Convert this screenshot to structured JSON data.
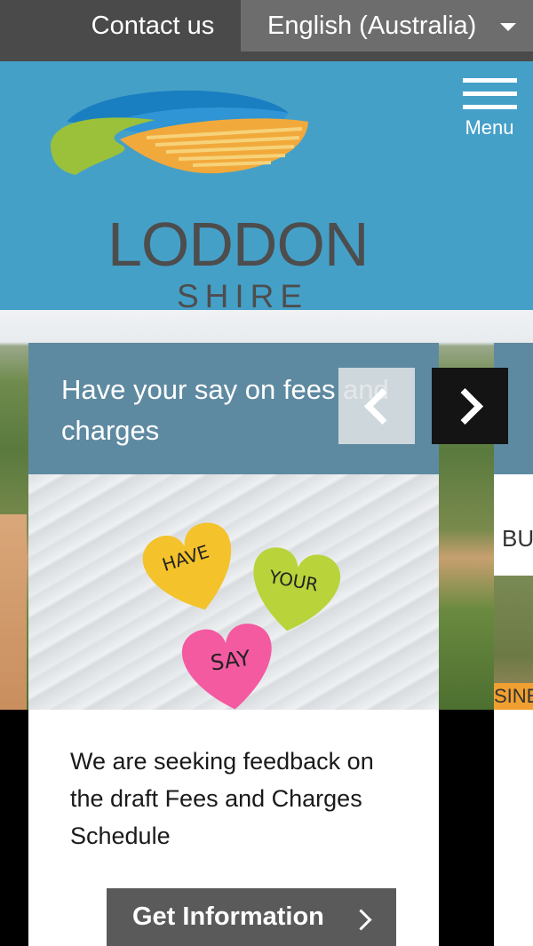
{
  "topbar": {
    "contact_label": "Contact us",
    "language_selected": "English (Australia)"
  },
  "header": {
    "logo_main": "LODDON",
    "logo_sub": "SHIRE",
    "menu_label": "Menu"
  },
  "carousel": {
    "slides": [
      {
        "title": "Have your say on fees and charges",
        "image_notes": [
          "HAVE",
          "YOUR",
          "SAY"
        ],
        "body": "We are seeking feedback on the draft Fees and Charges Schedule",
        "button_label": "Get Information"
      },
      {
        "section_label_partial": "BU",
        "banner_partial": "SINE"
      }
    ]
  },
  "colors": {
    "topbar": "#4a4a4a",
    "language_bg": "#6d6d6d",
    "header_bg": "#45a0c8",
    "card_header": "#5e8aa1",
    "button_bg": "#5a5a5a"
  }
}
